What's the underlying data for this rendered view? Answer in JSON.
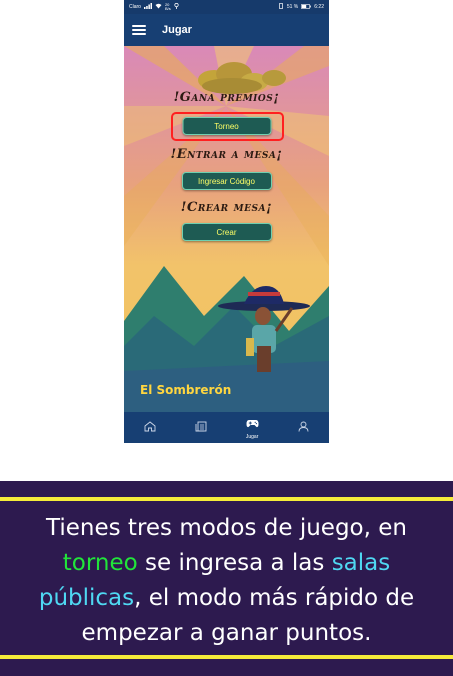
{
  "status_bar": {
    "carrier": "Claro",
    "speed_top": "20",
    "speed_unit": "B/s",
    "battery": "51 %",
    "time": "6:22"
  },
  "app_bar": {
    "title": "Jugar"
  },
  "game": {
    "heading_prizes": "!Gana premios¡",
    "button_tournament": "Torneo",
    "heading_enter": "!Entrar a mesa¡",
    "button_code": "Ingresar Código",
    "heading_create": "!Crear mesa¡",
    "button_create": "Crear",
    "brand": "El Sombrerón"
  },
  "bottom_nav": {
    "items": [
      {
        "icon": "home-icon",
        "label": ""
      },
      {
        "icon": "news-icon",
        "label": ""
      },
      {
        "icon": "gamepad-icon",
        "label": "Jugar"
      },
      {
        "icon": "profile-icon",
        "label": ""
      }
    ]
  },
  "caption": {
    "part1": "Tienes tres modos de juego,  en ",
    "highlight_torneo": "torneo",
    "part2": " se ingresa a las ",
    "highlight_salas": "salas públicas",
    "part3": ",  el modo más rápido de empezar a ganar puntos."
  },
  "colors": {
    "highlight_border": "#ff2020",
    "caption_bg": "#2d1a4f",
    "caption_line": "#f5ec3a",
    "torneo_color": "#21e53a",
    "salas_color": "#4fd8f2"
  }
}
